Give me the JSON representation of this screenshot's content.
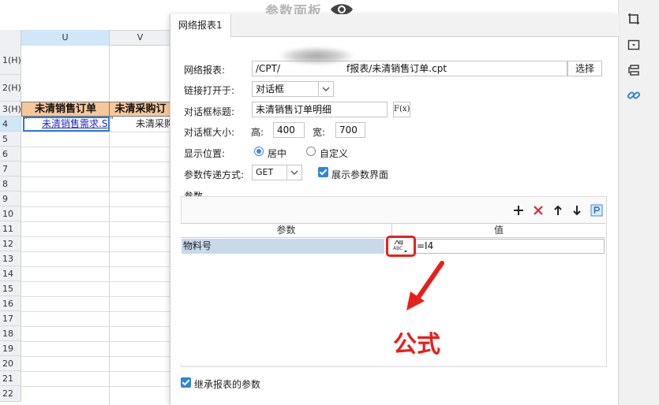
{
  "app": {
    "panel_title": "参数面板"
  },
  "sheet": {
    "columns": [
      "U",
      "V"
    ],
    "rows": [
      "1(H)",
      "2(H)",
      "3(H)",
      "4",
      "5",
      "6",
      "7",
      "8",
      "9",
      "10",
      "11",
      "12",
      "13",
      "14",
      "15",
      "16",
      "17",
      "18",
      "19",
      "20",
      "21",
      "22"
    ],
    "header_cells": [
      "未清销售订单",
      "未清采购订"
    ],
    "cell_u4": "未清销售需求.S",
    "cell_v4": "未清采购",
    "quote_mark": "\""
  },
  "dialog": {
    "tab": "网络报表1",
    "fields": {
      "report_label": "网络报表:",
      "report_path_left": "/CPT/",
      "report_path_right": "f报表/未清销售订单.cpt",
      "select_button": "选择",
      "open_in_label": "链接打开于:",
      "open_in_value": "对话框",
      "dialog_title_label": "对话框标题:",
      "dialog_title_value": "未清销售订单明细",
      "fx_button": "F(x)",
      "size_label": "对话框大小:",
      "height_label": "高:",
      "height_value": "400",
      "width_label": "宽:",
      "width_value": "700",
      "position_label": "显示位置:",
      "position_center": "居中",
      "position_custom": "自定义",
      "position_selected": "居中",
      "method_label": "参数传递方式:",
      "method_value": "GET",
      "show_params_label": "展示参数界面",
      "show_params_checked": true
    },
    "params": {
      "group_label": "参数",
      "columns": [
        "参数",
        "值"
      ],
      "rows": [
        {
          "name": "物料号",
          "value": "=I4"
        }
      ]
    },
    "inherit_label": "继承报表的参数",
    "inherit_checked": true,
    "annotation": "公式",
    "formula_icon_text": "ABC"
  },
  "colors": {
    "accent": "#2f86d8",
    "annotation": "#e8201c",
    "header_fill": "#f7c79a",
    "selected_row": "#c8d9e9"
  }
}
